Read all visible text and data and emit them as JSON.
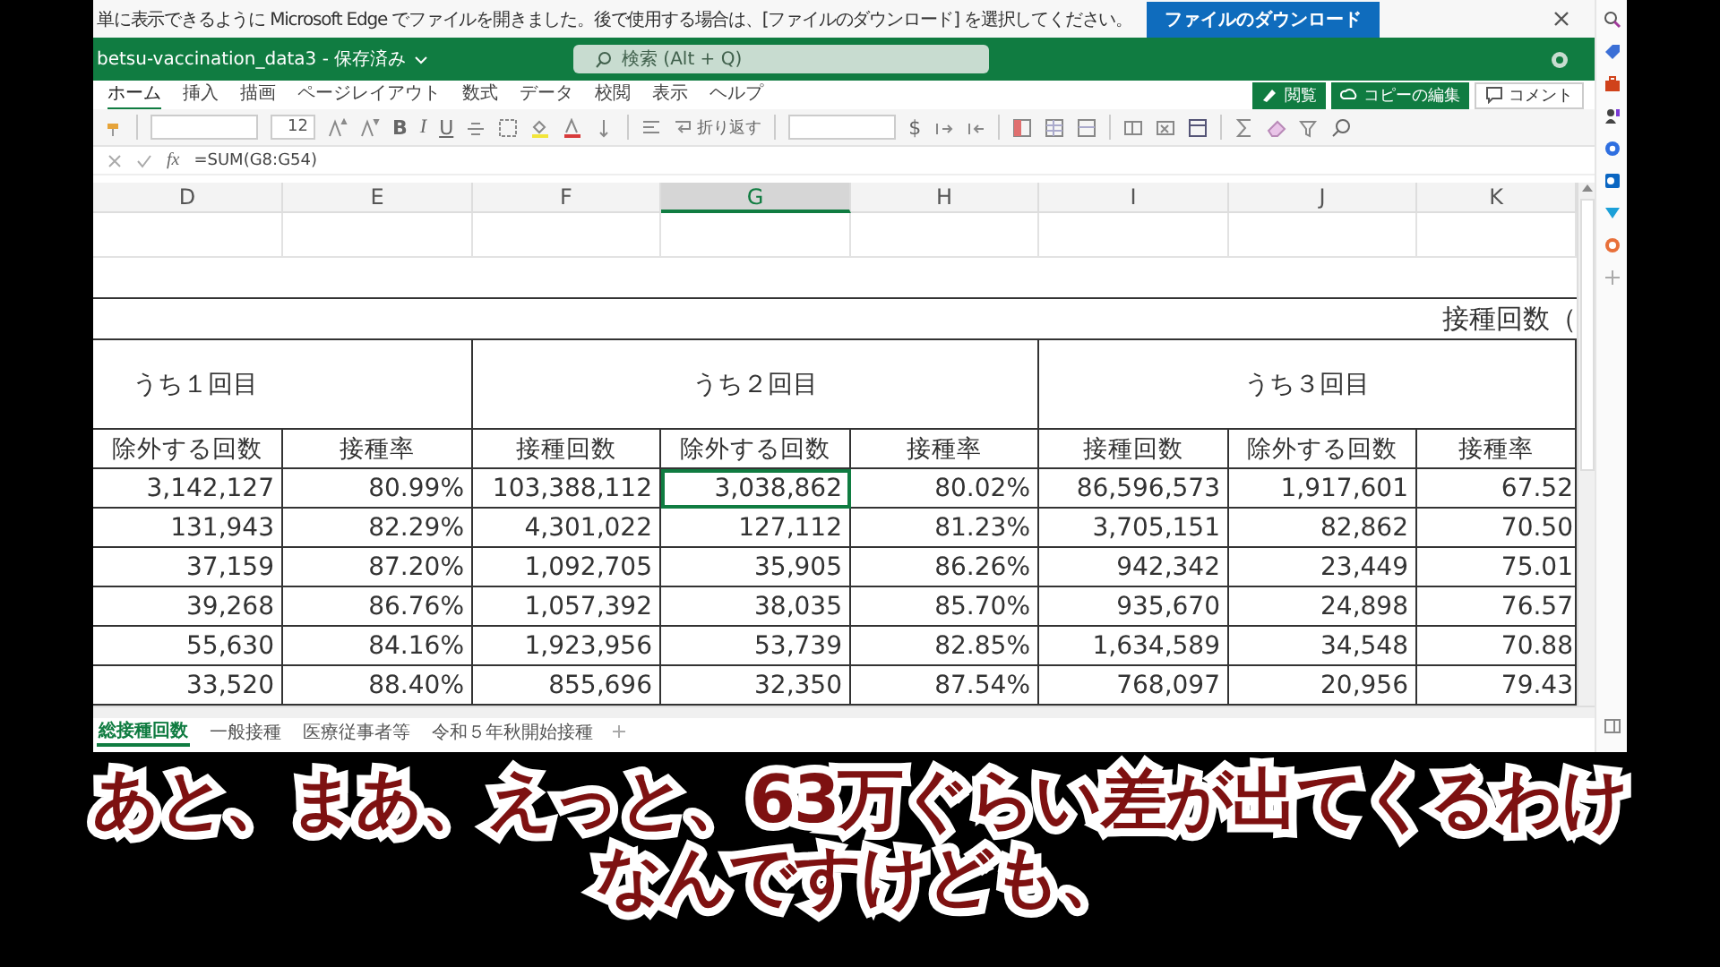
{
  "notification": {
    "message": "単に表示できるように Microsoft Edge でファイルを開きました。後で使用する場合は、[ファイルのダウンロード] を選択してください。",
    "button": "ファイルのダウンロード"
  },
  "title_bar": {
    "file_name": "betsu-vaccination_data3 - 保存済み",
    "search": {
      "placeholder": "検索 (Alt + Q)"
    }
  },
  "ribbon_tabs": [
    {
      "label": "ホーム",
      "selected": true
    },
    {
      "label": "挿入",
      "selected": false
    },
    {
      "label": "描画",
      "selected": false
    },
    {
      "label": "ページレイアウト",
      "selected": false
    },
    {
      "label": "数式",
      "selected": false
    },
    {
      "label": "データ",
      "selected": false
    },
    {
      "label": "校閲",
      "selected": false
    },
    {
      "label": "表示",
      "selected": false
    },
    {
      "label": "ヘルプ",
      "selected": false
    }
  ],
  "ribbon_actions": [
    "閲覧",
    "コピーの編集",
    "コメント"
  ],
  "toolbar": {
    "font_size": "12",
    "bold": "B",
    "italic": "I",
    "underline": "U",
    "wrap_text": "折り返す",
    "currency": "$"
  },
  "formula_bar": {
    "fx": "fx",
    "formula": "=SUM(G8:G54)"
  },
  "columns": [
    {
      "label": "D",
      "selected": false
    },
    {
      "label": "E",
      "selected": false
    },
    {
      "label": "F",
      "selected": false
    },
    {
      "label": "G",
      "selected": true
    },
    {
      "label": "H",
      "selected": false
    },
    {
      "label": "I",
      "selected": false
    },
    {
      "label": "J",
      "selected": false
    },
    {
      "label": "K",
      "selected": false
    }
  ],
  "sheet": {
    "title": "接種回数（",
    "groups": [
      "うち１回目",
      "うち２回目",
      "うち３回目"
    ],
    "headers": [
      "除外する回数",
      "接種率",
      "接種回数",
      "除外する回数",
      "接種率",
      "接種回数",
      "除外する回数",
      "接種率"
    ],
    "rows": [
      {
        "cells": [
          {
            "text": "3,142,127",
            "selected": false
          },
          {
            "text": "80.99%",
            "selected": false
          },
          {
            "text": "103,388,112",
            "selected": false
          },
          {
            "text": "3,038,862",
            "selected": true
          },
          {
            "text": "80.02%",
            "selected": false
          },
          {
            "text": "86,596,573",
            "selected": false
          },
          {
            "text": "1,917,601",
            "selected": false
          },
          {
            "text": "67.52",
            "selected": false
          }
        ]
      },
      {
        "cells": [
          {
            "text": "131,943",
            "selected": false
          },
          {
            "text": "82.29%",
            "selected": false
          },
          {
            "text": "4,301,022",
            "selected": false
          },
          {
            "text": "127,112",
            "selected": false
          },
          {
            "text": "81.23%",
            "selected": false
          },
          {
            "text": "3,705,151",
            "selected": false
          },
          {
            "text": "82,862",
            "selected": false
          },
          {
            "text": "70.50",
            "selected": false
          }
        ]
      },
      {
        "cells": [
          {
            "text": "37,159",
            "selected": false
          },
          {
            "text": "87.20%",
            "selected": false
          },
          {
            "text": "1,092,705",
            "selected": false
          },
          {
            "text": "35,905",
            "selected": false
          },
          {
            "text": "86.26%",
            "selected": false
          },
          {
            "text": "942,342",
            "selected": false
          },
          {
            "text": "23,449",
            "selected": false
          },
          {
            "text": "75.01",
            "selected": false
          }
        ]
      },
      {
        "cells": [
          {
            "text": "39,268",
            "selected": false
          },
          {
            "text": "86.76%",
            "selected": false
          },
          {
            "text": "1,057,392",
            "selected": false
          },
          {
            "text": "38,035",
            "selected": false
          },
          {
            "text": "85.70%",
            "selected": false
          },
          {
            "text": "935,670",
            "selected": false
          },
          {
            "text": "24,898",
            "selected": false
          },
          {
            "text": "76.57",
            "selected": false
          }
        ]
      },
      {
        "cells": [
          {
            "text": "55,630",
            "selected": false
          },
          {
            "text": "84.16%",
            "selected": false
          },
          {
            "text": "1,923,956",
            "selected": false
          },
          {
            "text": "53,739",
            "selected": false
          },
          {
            "text": "82.85%",
            "selected": false
          },
          {
            "text": "1,634,589",
            "selected": false
          },
          {
            "text": "34,548",
            "selected": false
          },
          {
            "text": "70.88",
            "selected": false
          }
        ]
      },
      {
        "cells": [
          {
            "text": "33,520",
            "selected": false
          },
          {
            "text": "88.40%",
            "selected": false
          },
          {
            "text": "855,696",
            "selected": false
          },
          {
            "text": "32,350",
            "selected": false
          },
          {
            "text": "87.54%",
            "selected": false
          },
          {
            "text": "768,097",
            "selected": false
          },
          {
            "text": "20,956",
            "selected": false
          },
          {
            "text": "79.43",
            "selected": false
          }
        ]
      }
    ]
  },
  "sheet_tabs": [
    {
      "label": "総接種回数",
      "selected": true
    },
    {
      "label": "一般接種",
      "selected": false
    },
    {
      "label": "医療従事者等",
      "selected": false
    },
    {
      "label": "令和５年秋開始接種",
      "selected": false
    }
  ],
  "caption": {
    "lines": [
      "あと、まあ、えっと、63万ぐらい差が出てくるわけ",
      "なんですけども、"
    ]
  }
}
